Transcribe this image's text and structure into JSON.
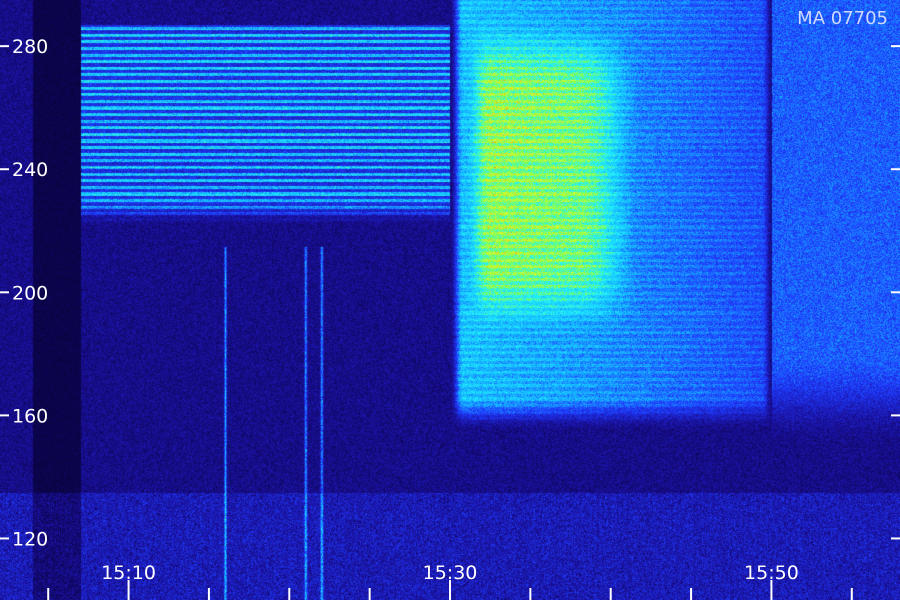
{
  "chart_data": {
    "type": "heatmap",
    "title": "",
    "xlabel": "",
    "ylabel": "",
    "corner_label": "MA 07705",
    "x_range": [
      "15:02",
      "15:58"
    ],
    "y_range": [
      100,
      295
    ],
    "x_tick_labels": [
      "15:10",
      "15:30",
      "15:50"
    ],
    "x_ticks_major": [
      "15:10",
      "15:30",
      "15:50"
    ],
    "x_ticks_minor": [
      "15:05",
      "15:15",
      "15:20",
      "15:25",
      "15:35",
      "15:40",
      "15:45",
      "15:55"
    ],
    "y_ticks": [
      120,
      160,
      200,
      240,
      280
    ],
    "colormap": [
      "#05002a",
      "#1a0f9a",
      "#1f3cff",
      "#15b8ff",
      "#20f2ff",
      "#7dff5a",
      "#d6ff2a",
      "#ff8a00",
      "#e8102a"
    ],
    "grid": false,
    "features": {
      "striped_band_freq": [
        222,
        287
      ],
      "striped_band_time": [
        "15:07",
        "15:30"
      ],
      "burst_time": [
        "15:30",
        "15:50"
      ],
      "burst_freq": [
        155,
        295
      ],
      "burst_peak_freq": [
        210,
        255
      ],
      "burst_peak_time": [
        "15:32",
        "15:38"
      ],
      "spikes_time": [
        "15:16",
        "15:21",
        "15:22"
      ],
      "late_emission_time": [
        "15:50",
        "15:58"
      ],
      "late_emission_freq": [
        150,
        295
      ]
    }
  }
}
